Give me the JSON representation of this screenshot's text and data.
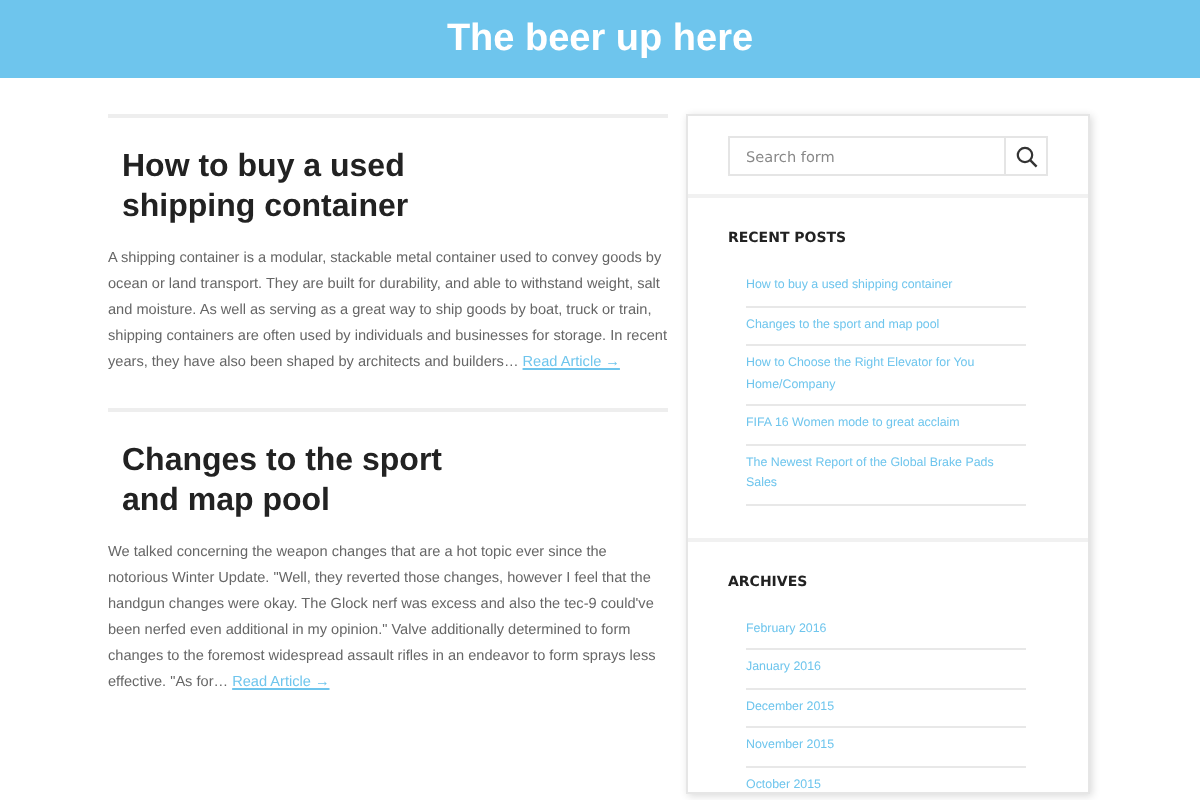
{
  "header": {
    "title": "The beer up here"
  },
  "articles": [
    {
      "title": "How to buy a used shipping container",
      "excerpt": "A shipping container is a modular, stackable metal container used to convey goods by ocean or land transport. They are built for durability, and able to withstand weight, salt and moisture. As well as serving as a great way to ship goods by boat, truck or train, shipping containers are often used by individuals and businesses for storage. In recent years, they have also been shaped by architects and builders…",
      "link": "Read Article →"
    },
    {
      "title": "Changes to the sport and map pool",
      "excerpt": "We talked concerning the weapon changes that are a hot topic ever since the notorious Winter Update. \"Well, they reverted those changes, however I feel that the handgun changes were okay. The Glock nerf was excess and also the tec-9 could've been nerfed even additional in my opinion.\" Valve additionally determined to form changes to the foremost widespread assault rifles in an endeavor to form sprays less effective. \"As for…",
      "link": "Read Article →"
    }
  ],
  "sidebar": {
    "search": {
      "placeholder": "Search form"
    },
    "widgets": [
      {
        "title": "RECENT POSTS",
        "items": [
          "How to buy a used shipping container",
          "Changes to the sport and map pool",
          "How to Choose the Right Elevator for You Home/Company",
          "FIFA 16 Women mode to great acclaim",
          "The Newest Report of the Global Brake Pads Sales"
        ]
      },
      {
        "title": "ARCHIVES",
        "items": [
          "February 2016",
          "January 2016",
          "December 2015",
          "November 2015",
          "October 2015"
        ]
      }
    ]
  }
}
